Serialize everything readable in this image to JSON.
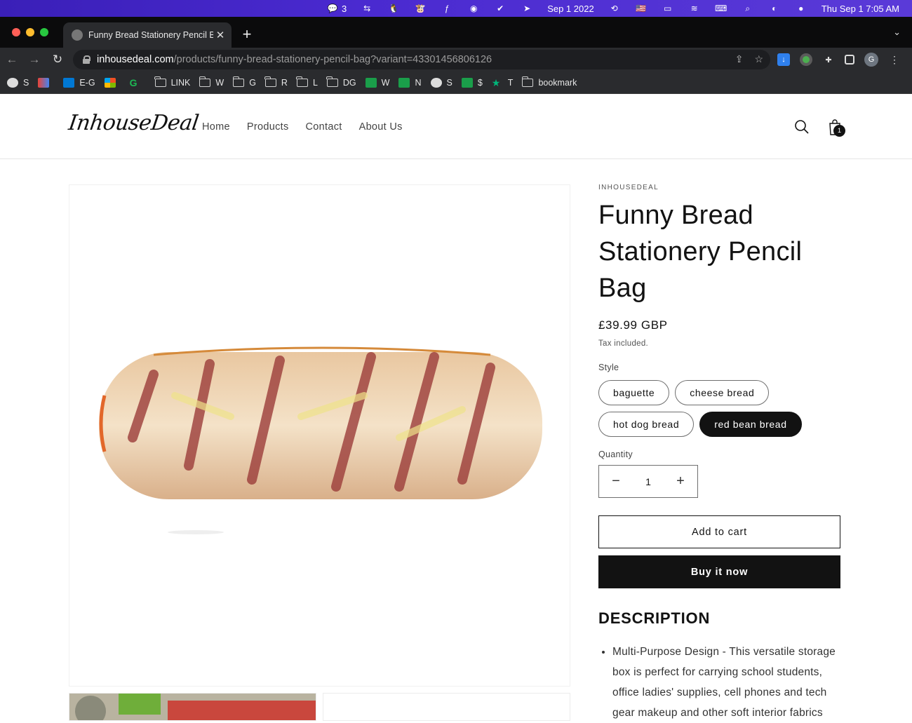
{
  "menubar": {
    "wechat_count": "3",
    "date": "Sep 1 2022",
    "clock": "Thu Sep 1  7:05 AM"
  },
  "browser": {
    "tab_title": "Funny Bread Stationery Pencil Bag",
    "url_host": "inhousedeal.com",
    "url_path": "/products/funny-bread-stationery-pencil-bag?variant=43301456806126",
    "profile_initial": "G",
    "bookmarks": [
      "S",
      "",
      "E-G",
      "",
      "",
      "LINK",
      "W",
      "G",
      "R",
      "L",
      "DG",
      "W",
      "N",
      "S",
      "$",
      "T",
      "bookmark"
    ]
  },
  "site": {
    "logo": "InhouseDeal",
    "nav": [
      "Home",
      "Products",
      "Contact",
      "About Us"
    ],
    "cart_count": "1"
  },
  "product": {
    "vendor": "INHOUSEDEAL",
    "title": "Funny Bread Stationery Pencil Bag",
    "price": "£39.99 GBP",
    "tax_note": "Tax included.",
    "style_label": "Style",
    "styles": [
      "baguette",
      "cheese bread",
      "hot dog bread",
      "red bean bread"
    ],
    "selected_style": "red bean bread",
    "quantity_label": "Quantity",
    "quantity": "1",
    "add_to_cart": "Add to cart",
    "buy_now": "Buy it now",
    "description_heading": "DESCRIPTION",
    "description_items": [
      "Multi-Purpose Design - This versatile storage box is perfect for carrying school students, office ladies' supplies, cell phones and tech gear makeup and other soft interior fabrics"
    ]
  },
  "colors": {
    "menubar": "#4a2ad0",
    "chrome_dark": "#2a2b2e",
    "ink": "#121212"
  }
}
